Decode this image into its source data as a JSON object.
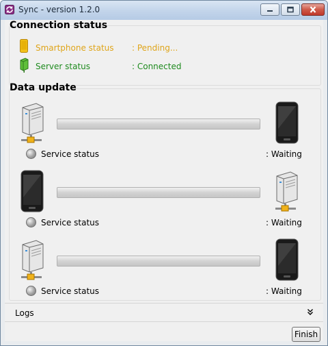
{
  "window": {
    "title": "Sync - version 1.2.0"
  },
  "connection": {
    "heading": "Connection status",
    "items": [
      {
        "label": "Smartphone status",
        "value": ": Pending...",
        "state": "pending",
        "icon": "smartphone-icon"
      },
      {
        "label": "Server status",
        "value": ": Connected",
        "state": "connected",
        "icon": "server-green-icon"
      }
    ]
  },
  "update": {
    "heading": "Data update",
    "rows": [
      {
        "left_icon": "server-icon",
        "right_icon": "phone-icon",
        "progress": 0,
        "service_label": "Service status",
        "status": ": Waiting"
      },
      {
        "left_icon": "phone-icon",
        "right_icon": "server-icon",
        "progress": 0,
        "service_label": "Service status",
        "status": ": Waiting"
      },
      {
        "left_icon": "server-icon",
        "right_icon": "phone-icon",
        "progress": 0,
        "service_label": "Service status",
        "status": ": Waiting"
      }
    ]
  },
  "logs": {
    "label": "Logs",
    "toggle_icon": "double-chevron-down-icon"
  },
  "footer": {
    "finish_label": "Finish"
  },
  "colors": {
    "pending": "#dfa51a",
    "connected": "#1e8a1e"
  }
}
